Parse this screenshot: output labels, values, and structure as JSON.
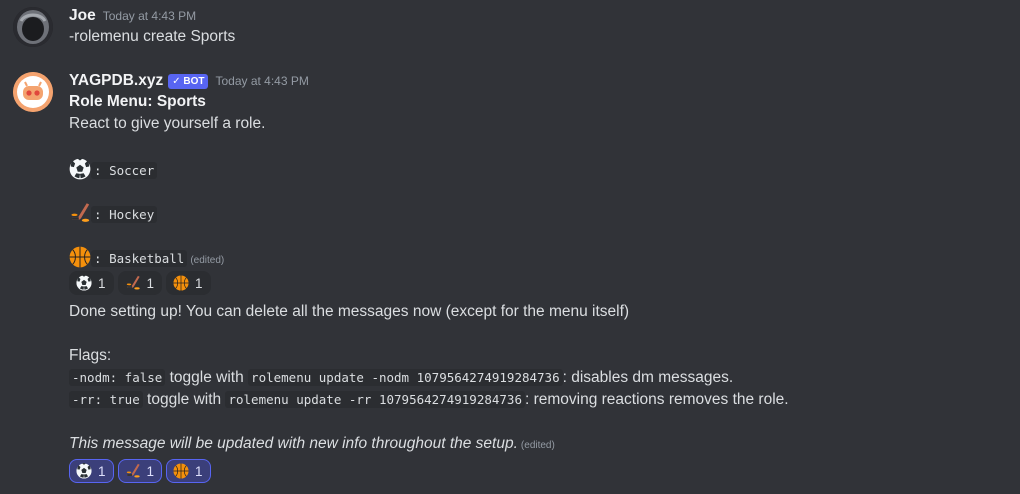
{
  "messages": [
    {
      "author": "Joe",
      "timestamp": "Today at 4:43 PM",
      "text": "-rolemenu create Sports"
    },
    {
      "author": "YAGPDB.xyz",
      "badge": "✓ BOT",
      "timestamp": "Today at 4:43 PM",
      "title": "Role Menu: Sports",
      "subtitle": "React to give yourself a role.",
      "options": [
        {
          "icon": "soccer-ball-icon",
          "label": "Soccer"
        },
        {
          "icon": "hockey-stick-icon",
          "label": "Hockey"
        },
        {
          "icon": "basketball-icon",
          "label": "Basketball"
        }
      ],
      "edited": "(edited)",
      "reactions": [
        {
          "icon": "soccer-ball-icon",
          "count": "1"
        },
        {
          "icon": "hockey-stick-icon",
          "count": "1"
        },
        {
          "icon": "basketball-icon",
          "count": "1"
        }
      ]
    },
    {
      "text_done": "Done setting up! You can delete all the messages now (except for the menu itself)",
      "flags_label": "Flags:",
      "flag1": {
        "code": "-nodm: false",
        "mid": "toggle with",
        "cmd": "rolemenu update -nodm 1079564274919284736",
        "desc": ": disables dm messages."
      },
      "flag2": {
        "code": "-rr: true",
        "mid": "toggle with",
        "cmd": "rolemenu update -rr 1079564274919284736",
        "desc": ": removing reactions removes the role."
      },
      "footer": "This message will be updated with new info throughout the setup.",
      "edited": "(edited)",
      "reactions": [
        {
          "icon": "soccer-ball-icon",
          "count": "1"
        },
        {
          "icon": "hockey-stick-icon",
          "count": "1"
        },
        {
          "icon": "basketball-icon",
          "count": "1"
        }
      ]
    }
  ],
  "colors": {
    "background": "#313338",
    "accent": "#5865f2",
    "code_bg": "#2b2d31"
  }
}
